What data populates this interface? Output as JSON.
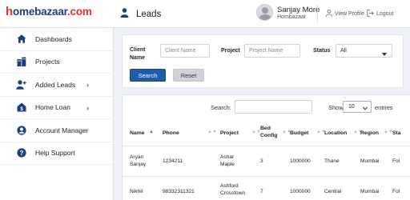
{
  "brand": {
    "logo_prefix": "h",
    "logo_main": "omebazaar",
    "logo_suffix": ".com",
    "logo_color": "#1e3d7d",
    "logo_accent": "#e8312b"
  },
  "header": {
    "title": "Leads",
    "user_name": "Sanjay More",
    "user_org": "Hombazaar",
    "view_profile": "View Profile",
    "logout": "Logout"
  },
  "sidebar": {
    "items": [
      {
        "label": "Dashboards",
        "icon": "home-icon",
        "chevron": ""
      },
      {
        "label": "Projects",
        "icon": "buildings-icon",
        "chevron": ""
      },
      {
        "label": "Added Leads",
        "icon": "add-user-icon",
        "chevron": "›"
      },
      {
        "label": "Home Loan",
        "icon": "home-loan-icon",
        "chevron": "›"
      },
      {
        "label": "Account Manager",
        "icon": "account-icon",
        "chevron": ""
      },
      {
        "label": "Help Support",
        "icon": "help-icon",
        "chevron": ""
      }
    ]
  },
  "filters": {
    "client_name_label": "Client Name",
    "client_name_placeholder": "Client Name",
    "project_label": "Project",
    "project_placeholder": "Project Name",
    "status_label": "Status",
    "status_value": "All",
    "search_button": "Search",
    "reset_button": "Reset"
  },
  "table_controls": {
    "search_label": "Search:",
    "show_label": "Show",
    "show_value": "10",
    "entries_label": "entries"
  },
  "table": {
    "headers": [
      "Name",
      "Phone",
      "Project",
      "Bed Config",
      "Budget",
      "Location",
      "Region",
      "Sta"
    ],
    "rows": [
      [
        "Aryan Sanjay",
        "1234211",
        "Ashar Maple",
        "3",
        "1000000",
        "Thane",
        "Mumbai",
        "Fol"
      ],
      [
        "Nikhil",
        "98332311321",
        "Ashford Crosstown",
        "7",
        "1000000",
        "Central",
        "Mumbai",
        "Fol"
      ]
    ]
  },
  "colors": {
    "primary": "#1f5da8",
    "sidebar_icon": "#1e3d7d",
    "sort_active": "#4a6ee0"
  }
}
